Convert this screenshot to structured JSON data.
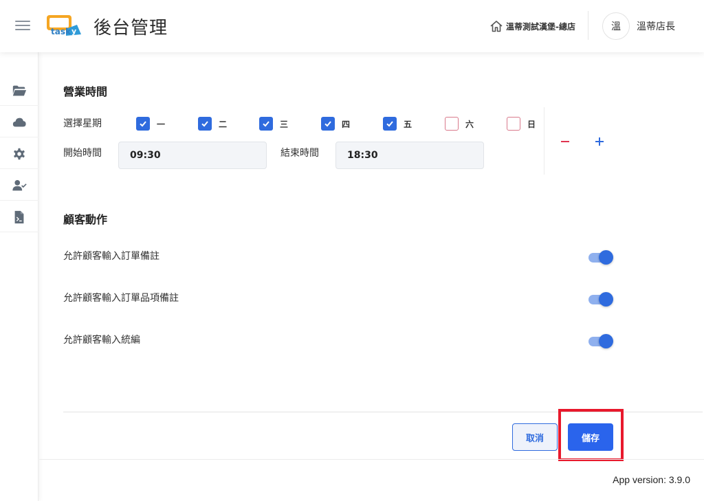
{
  "header": {
    "menu_icon": "hamburger-icon",
    "logo_text": "tasky",
    "title": "後台管理",
    "store_name": "溫蒂測試漢堡-總店",
    "avatar_text": "溫",
    "user_name": "溫蒂店長"
  },
  "sidebar": {
    "items": [
      {
        "icon": "folder-open-icon"
      },
      {
        "icon": "cloud-icon"
      },
      {
        "icon": "gear-icon"
      },
      {
        "icon": "user-check-icon"
      },
      {
        "icon": "report-file-icon"
      }
    ]
  },
  "business_hours": {
    "title": "營業時間",
    "weekday_label": "選擇星期",
    "days": [
      {
        "label": "一",
        "checked": true
      },
      {
        "label": "二",
        "checked": true
      },
      {
        "label": "三",
        "checked": true
      },
      {
        "label": "四",
        "checked": true
      },
      {
        "label": "五",
        "checked": true
      },
      {
        "label": "六",
        "checked": false
      },
      {
        "label": "日",
        "checked": false
      }
    ],
    "start_label": "開始時間",
    "start_value": "09:30",
    "end_label": "結束時間",
    "end_value": "18:30"
  },
  "customer_actions": {
    "title": "顧客動作",
    "options": [
      {
        "label": "允許顧客輸入訂單備註",
        "enabled": true
      },
      {
        "label": "允許顧客輸入訂單品項備註",
        "enabled": true
      },
      {
        "label": "允許顧客輸入統編",
        "enabled": true
      }
    ]
  },
  "actions": {
    "cancel_label": "取消",
    "save_label": "儲存"
  },
  "footer": {
    "version": "App version: 3.9.0"
  },
  "colors": {
    "accent": "#2f6bde",
    "highlight": "#e8192c",
    "minus": "#e0344f"
  }
}
